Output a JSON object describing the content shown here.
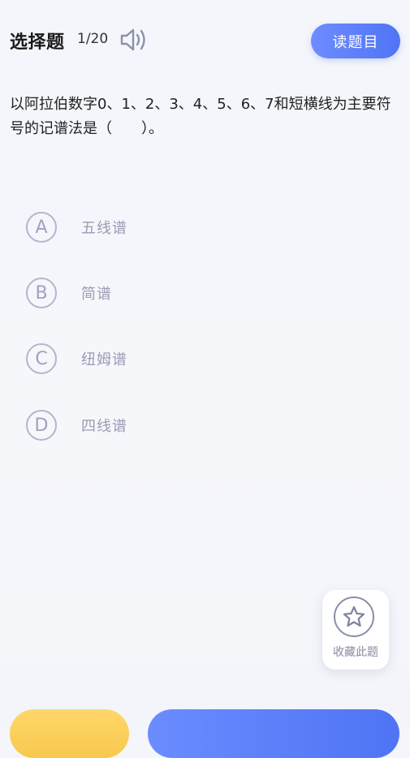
{
  "header": {
    "title": "选择题",
    "progress": "1/20",
    "read_button": "读题目"
  },
  "question": {
    "text": "以阿拉伯数字0、1、2、3、4、5、6、7和短横线为主要符号的记谱法是（　　）。"
  },
  "options": [
    {
      "letter": "A",
      "text": "五线谱"
    },
    {
      "letter": "B",
      "text": "简谱"
    },
    {
      "letter": "C",
      "text": "纽姆谱"
    },
    {
      "letter": "D",
      "text": "四线谱"
    }
  ],
  "favorite": {
    "label": "收藏此题"
  },
  "icons": {
    "speaker": "speaker-icon",
    "star": "star-icon"
  },
  "colors": {
    "accent": "#4f74f4",
    "option_border": "#b3b6cf",
    "yellow_button": "#f8c84d"
  }
}
